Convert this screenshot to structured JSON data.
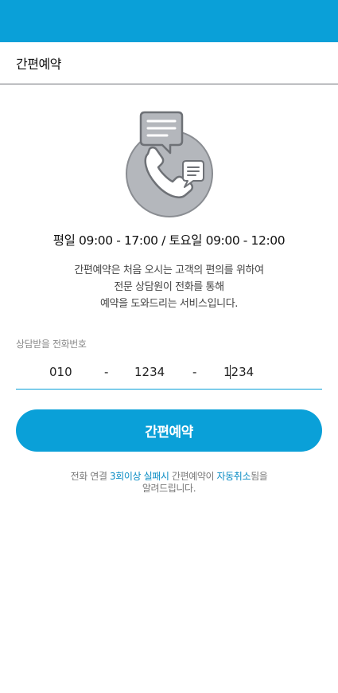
{
  "header": {
    "title": "간편예약"
  },
  "hero": {
    "icon": "phone-chat-icon"
  },
  "hours": "평일 09:00 - 17:00 / 토요일 09:00 - 12:00",
  "description": {
    "line1": "간편예약은 처음 오시는 고객의 편의를 위하여",
    "line2": "전문 상담원이 전화를 통해",
    "line3": "예약을 도와드리는 서비스입니다."
  },
  "phone": {
    "label": "상담받을 전화번호",
    "part1": "010",
    "sep1": "-",
    "part2": "1234",
    "sep2": "-",
    "part3": "1234"
  },
  "submit_label": "간편예약",
  "notice": {
    "t1": "전화 연결 ",
    "h1": "3회이상 실패시",
    "t2": " 간편예약이 ",
    "h2": "자동취소",
    "t3": "됨을",
    "t4": "알려드립니다."
  },
  "colors": {
    "accent": "#0aa0d8",
    "icon_gray": "#b4b7bc"
  }
}
